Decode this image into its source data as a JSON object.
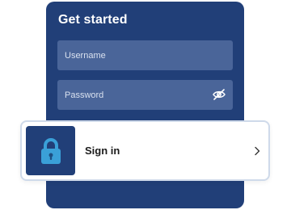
{
  "card": {
    "title": "Get started"
  },
  "form": {
    "username_placeholder": "Username",
    "password_placeholder": "Password"
  },
  "signin": {
    "label": "Sign in"
  },
  "icons": {
    "password_toggle": "eye-off-icon",
    "lock": "lock-icon",
    "chevron": "chevron-right-icon"
  },
  "colors": {
    "card_bg": "#213f78",
    "field_bg": "#4a6599",
    "lock_accent": "#3aa0d8",
    "bar_border": "#cfdaea"
  }
}
